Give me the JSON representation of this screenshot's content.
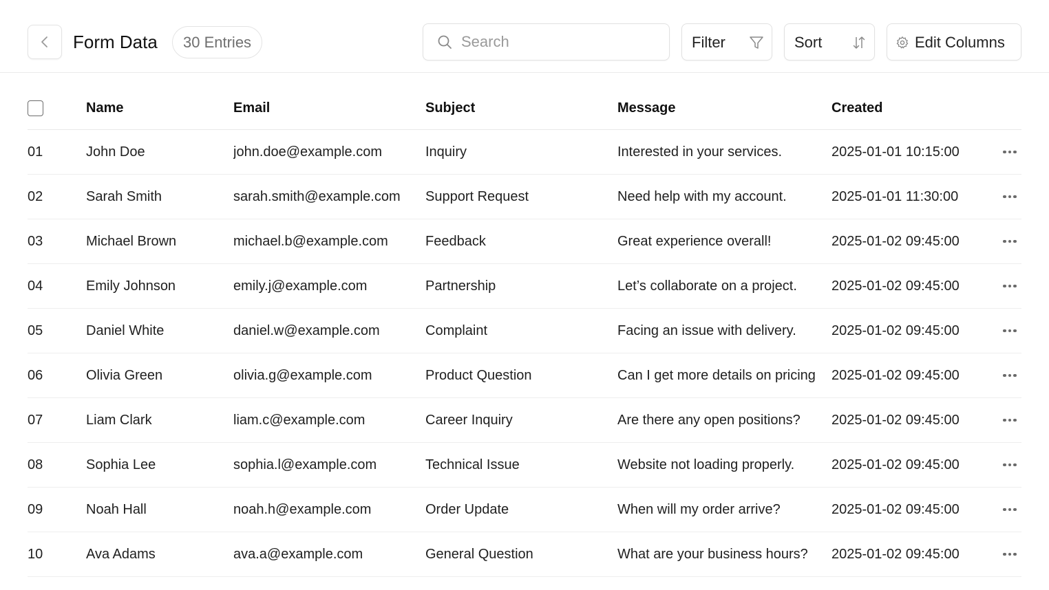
{
  "header": {
    "title": "Form Data",
    "entries_badge": "30 Entries",
    "search_placeholder": "Search",
    "filter_label": "Filter",
    "sort_label": "Sort",
    "edit_columns_label": "Edit Columns"
  },
  "table": {
    "columns": [
      "Name",
      "Email",
      "Subject",
      "Message",
      "Created"
    ],
    "rows": [
      {
        "idx": "01",
        "name": "John Doe",
        "email": "john.doe@example.com",
        "subject": "Inquiry",
        "message": "Interested in your services.",
        "created": "2025-01-01 10:15:00"
      },
      {
        "idx": "02",
        "name": "Sarah Smith",
        "email": "sarah.smith@example.com",
        "subject": "Support Request",
        "message": "Need help with my account.",
        "created": "2025-01-01 11:30:00"
      },
      {
        "idx": "03",
        "name": "Michael Brown",
        "email": "michael.b@example.com",
        "subject": "Feedback",
        "message": "Great experience overall!",
        "created": "2025-01-02 09:45:00"
      },
      {
        "idx": "04",
        "name": "Emily Johnson",
        "email": "emily.j@example.com",
        "subject": "Partnership",
        "message": "Let’s collaborate on a project.",
        "created": "2025-01-02 09:45:00"
      },
      {
        "idx": "05",
        "name": "Daniel White",
        "email": "daniel.w@example.com",
        "subject": "Complaint",
        "message": "Facing an issue with delivery.",
        "created": "2025-01-02 09:45:00"
      },
      {
        "idx": "06",
        "name": "Olivia Green",
        "email": "olivia.g@example.com",
        "subject": "Product Question",
        "message": "Can I get more details on pricing",
        "created": "2025-01-02 09:45:00"
      },
      {
        "idx": "07",
        "name": "Liam Clark",
        "email": "liam.c@example.com",
        "subject": "Career Inquiry",
        "message": "Are there any open positions?",
        "created": "2025-01-02 09:45:00"
      },
      {
        "idx": "08",
        "name": "Sophia Lee",
        "email": "sophia.l@example.com",
        "subject": "Technical Issue",
        "message": "Website not loading properly.",
        "created": "2025-01-02 09:45:00"
      },
      {
        "idx": "09",
        "name": "Noah Hall",
        "email": "noah.h@example.com",
        "subject": "Order Update",
        "message": "When will my order arrive?",
        "created": "2025-01-02 09:45:00"
      },
      {
        "idx": "10",
        "name": "Ava Adams",
        "email": "ava.a@example.com",
        "subject": "General Question",
        "message": "What are your business hours?",
        "created": "2025-01-02 09:45:00"
      }
    ]
  },
  "icons": {
    "back": "chevron-left-icon",
    "search": "search-icon",
    "filter": "funnel-icon",
    "sort": "sort-arrows-icon",
    "edit_columns": "gear-icon",
    "row_actions": "more-horizontal-icon"
  }
}
